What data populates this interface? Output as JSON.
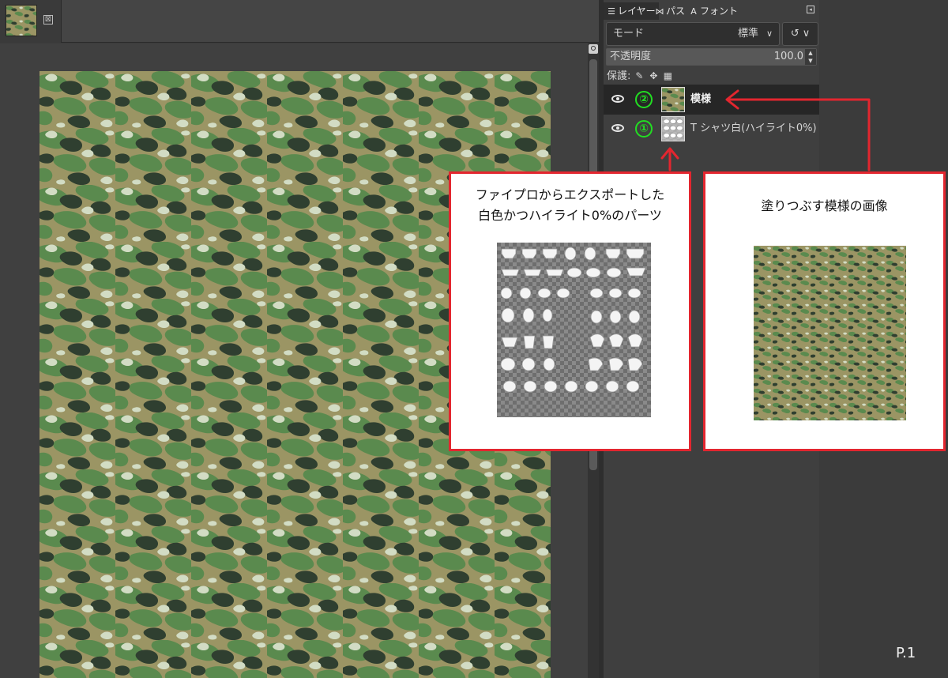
{
  "image_tab": {
    "close_glyph": "⊠"
  },
  "dock": {
    "tabs": [
      {
        "icon": "layers-icon",
        "glyph": "☰",
        "label": "レイヤー"
      },
      {
        "icon": "paths-icon",
        "glyph": "⋈",
        "label": "パス"
      },
      {
        "icon": "fonts-icon",
        "glyph": "A",
        "label": "フォント"
      }
    ],
    "menu_glyph": "◂",
    "mode": {
      "label": "モード",
      "value": "標準",
      "chevron": "∨"
    },
    "composite": {
      "glyph": "↺ ∨"
    },
    "opacity": {
      "label": "不透明度",
      "value": "100.0"
    },
    "lock": {
      "label": "保護:",
      "icons": [
        "brush-lock-icon",
        "position-lock-icon",
        "alpha-lock-icon"
      ],
      "glyphs": [
        "✎",
        "✥",
        "▦"
      ]
    },
    "layers": [
      {
        "badge": "②",
        "name": "模様",
        "selected": true
      },
      {
        "badge": "①",
        "name": "T シャツ白(ハイライト0%)",
        "selected": false
      }
    ]
  },
  "callouts": {
    "left": {
      "lines": [
        "ファイプロからエクスポートした",
        "白色かつハイライト0%のパーツ"
      ]
    },
    "right": {
      "lines": [
        "塗りつぶす模様の画像"
      ]
    }
  },
  "page_number": "P.1",
  "colors": {
    "annotation_red": "#e3262f",
    "badge_green": "#22dd22",
    "camo": [
      "#9b9564",
      "#5a8a4e",
      "#2f3f30",
      "#d2dcc4"
    ]
  }
}
